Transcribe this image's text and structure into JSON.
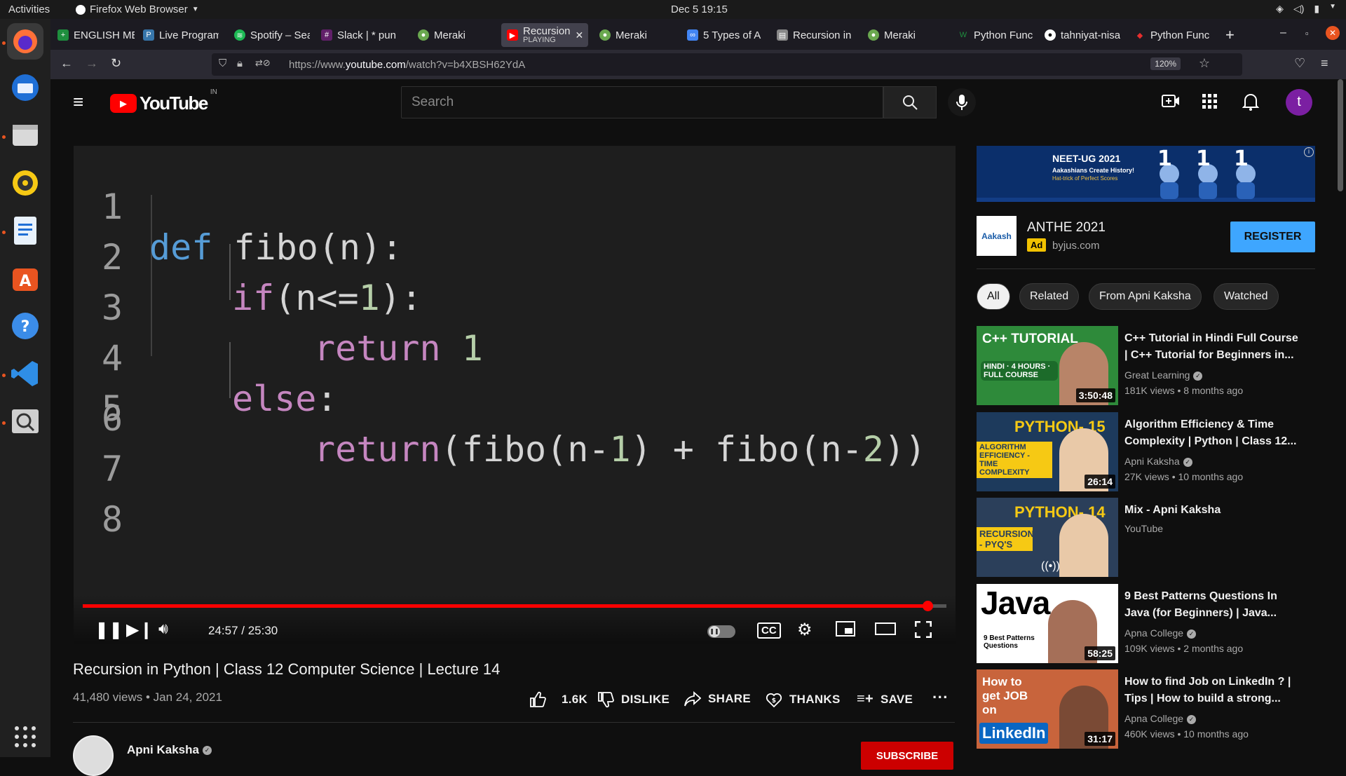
{
  "os": {
    "activities": "Activities",
    "app_menu": "Firefox Web Browser",
    "clock": "Dec 5  19:15"
  },
  "tabs": [
    {
      "label": "ENGLISH ME",
      "fav_color": "#1e8e3e"
    },
    {
      "label": "Live Program",
      "fav_color": "#3776ab"
    },
    {
      "label": "Spotify – Sea",
      "fav_color": "#1db954"
    },
    {
      "label": "Slack | * pun",
      "fav_color": "#611f69"
    },
    {
      "label": "Meraki",
      "fav_color": "#6aa84f"
    },
    {
      "label": "Recursion",
      "sub": "PLAYING",
      "fav_color": "#ff0000",
      "active": true
    },
    {
      "label": "Meraki",
      "fav_color": "#6aa84f"
    },
    {
      "label": "5 Types of A",
      "fav_color": "#4285f4"
    },
    {
      "label": "Recursion in",
      "fav_color": "#888888"
    },
    {
      "label": "Meraki",
      "fav_color": "#6aa84f"
    },
    {
      "label": "Python Func",
      "fav_color": "#1e8e3e"
    },
    {
      "label": "tahniyat-nisa",
      "fav_color": "#ffffff"
    },
    {
      "label": "Python Func",
      "fav_color": "#e62e2e"
    }
  ],
  "browser": {
    "url_prefix": "https://www.",
    "url_domain": "youtube.com",
    "url_path": "/watch?v=b4XBSH62YdA",
    "zoom": "120%"
  },
  "youtube": {
    "logo_text": "YouTube",
    "region": "IN",
    "search_placeholder": "Search",
    "avatar_letter": "t"
  },
  "video": {
    "code_lines": [
      {
        "n": "1",
        "text": "def fibo(n):"
      },
      {
        "n": "2",
        "text": "if(n<=1):"
      },
      {
        "n": "3",
        "text": "return 1"
      },
      {
        "n": "4",
        "text": "else:"
      },
      {
        "n": "5",
        "text": "return(fibo(n-1) + fibo(n-2))"
      },
      {
        "n": "6",
        "text": ""
      },
      {
        "n": "7",
        "text": ""
      },
      {
        "n": "8",
        "text": ""
      }
    ],
    "time_display": "24:57 / 25:30",
    "progress": 0.978,
    "title": "Recursion in Python | Class 12 Computer Science | Lecture 14",
    "meta": "41,480 views • Jan 24, 2021",
    "actions": {
      "likes": "1.6K",
      "dislike": "DISLIKE",
      "share": "SHARE",
      "thanks": "THANKS",
      "save": "SAVE"
    },
    "channel": "Apni Kaksha",
    "subscribe": "SUBSCRIBE"
  },
  "ad": {
    "banner_headline": "NEET-UG 2021",
    "banner_sub": "Aakashians Create History!",
    "banner_sub2": "Hat-trick of Perfect Scores",
    "logo_text": "Aakash",
    "title": "ANTHE 2021",
    "badge": "Ad",
    "domain": "byjus.com",
    "cta": "REGISTER"
  },
  "chips": [
    "All",
    "Related",
    "From Apni Kaksha",
    "Watched"
  ],
  "recommendations": [
    {
      "title": "C++ Tutorial in Hindi Full Course | C++ Tutorial for Beginners in...",
      "channel": "Great Learning",
      "stats": "181K views • 8 months ago",
      "duration": "3:50:48",
      "thumb_title": "C++ TUTORIAL",
      "thumb_sub": "HINDI · 4 HOURS · FULL COURSE",
      "thumb_bg": "#2e8a3a",
      "verified": true
    },
    {
      "title": "Algorithm Efficiency & Time Complexity | Python | Class 12...",
      "channel": "Apni Kaksha",
      "stats": "27K views • 10 months ago",
      "duration": "26:14",
      "thumb_title": "PYTHON- 15",
      "thumb_sub": "ALGORITHM EFFICIENCY - TIME COMPLEXITY",
      "thumb_bg": "#1d3a5c",
      "verified": true
    },
    {
      "title": "Mix - Apni Kaksha",
      "channel": "YouTube",
      "stats": "",
      "duration": "",
      "thumb_title": "PYTHON- 14",
      "thumb_sub": "RECURSION - PYQ'S",
      "thumb_bg": "#2b3f5a",
      "verified": false
    },
    {
      "title": "9 Best Patterns Questions In Java (for Beginners) | Java...",
      "channel": "Apna College",
      "stats": "109K views • 2 months ago",
      "duration": "58:25",
      "thumb_title": "Java",
      "thumb_sub": "9 Best Patterns Questions",
      "thumb_bg": "#ffffff",
      "verified": true
    },
    {
      "title": "How to find Job on LinkedIn ? | Tips | How to build a strong...",
      "channel": "Apna College",
      "stats": "460K views • 10 months ago",
      "duration": "31:17",
      "thumb_title": "How to get JOB on",
      "thumb_sub": "LinkedIn",
      "thumb_bg": "#c8643c",
      "verified": true
    }
  ],
  "colors": {
    "yt_red": "#ff0000",
    "accent_blue": "#3ea6ff",
    "avatar_purple": "#7b1fa2",
    "ubuntu_orange": "#e95420"
  }
}
